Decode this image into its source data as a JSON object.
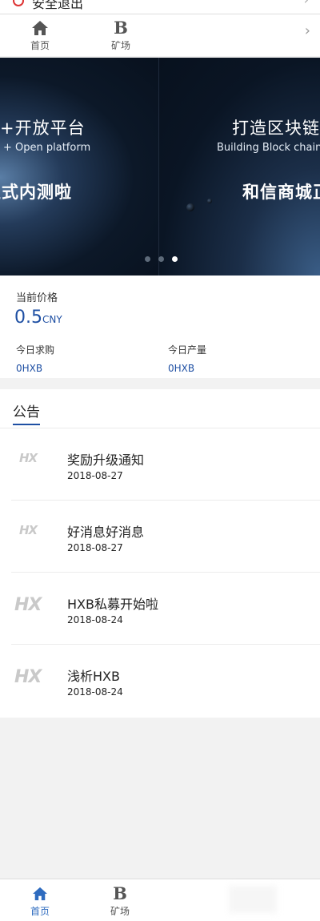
{
  "top_bar": {
    "partial_label": "安全退出"
  },
  "top_nav": {
    "items": [
      {
        "label": "首页",
        "icon": "home-icon"
      },
      {
        "label": "矿场",
        "icon": "b-letter-icon",
        "glyph": "B"
      }
    ]
  },
  "banner": {
    "left": {
      "title": "+开放平台",
      "subtitle": "+ Open platform",
      "big": "正式内测啦"
    },
    "right": {
      "title": "打造区块链",
      "subtitle": "Building Block chain",
      "big": "和信商城正"
    },
    "dots": 3,
    "active_dot": 2
  },
  "price": {
    "label": "当前价格",
    "value": "0.5",
    "unit": "CNY",
    "stats": [
      {
        "label": "今日求购",
        "value": "0HXB"
      },
      {
        "label": "今日产量",
        "value": "0HXB"
      }
    ]
  },
  "notice": {
    "title": "公告",
    "logo_text": "HX",
    "items": [
      {
        "title": "奖励升级通知",
        "date": "2018-08-27"
      },
      {
        "title": "好消息好消息",
        "date": "2018-08-27"
      },
      {
        "title": "HXB私募开始啦",
        "date": "2018-08-24"
      },
      {
        "title": "浅析HXB",
        "date": "2018-08-24"
      }
    ]
  },
  "bottom_nav": {
    "items": [
      {
        "label": "首页",
        "icon": "home-icon"
      },
      {
        "label": "矿场",
        "icon": "b-letter-icon",
        "glyph": "B"
      }
    ]
  },
  "colors": {
    "accent": "#1e4fa3",
    "active_nav": "#2e6bbf"
  }
}
